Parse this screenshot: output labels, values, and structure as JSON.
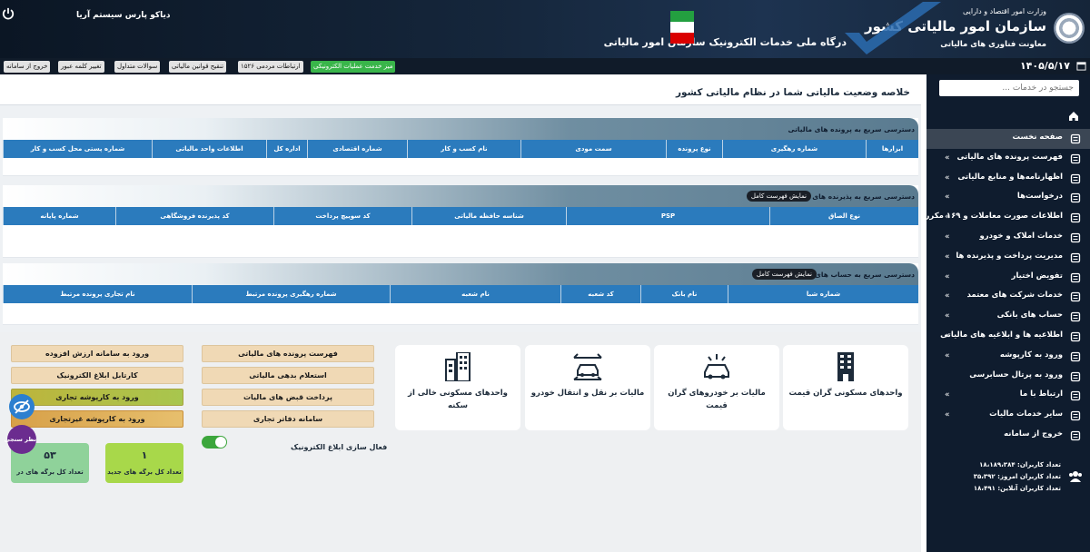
{
  "header": {
    "ministry": "وزارت امور اقتصاد و دارایی",
    "org": "سازمان امور مالیاتی کشور",
    "deputy": "معاونت فناوری های مالیاتی",
    "portal": "درگاه ملی خدمات الکترونیک سازمان امور مالیاتی",
    "system_name": "دیاکو پارس سیستم آریا"
  },
  "navrow": {
    "date": "۱۴۰۵/۵/۱۷",
    "links": [
      "میز خدمت عملیات الکترونیکی",
      "ارتباطات مردمی ۱۵۲۶",
      "تنقیح قوانین مالیاتی",
      "سوالات متداول",
      "تغییر کلمه عبور",
      "خروج از سامانه"
    ]
  },
  "sidebar": {
    "search_placeholder": "جستجو در خدمات ...",
    "items": [
      {
        "label": "صفحه نخست",
        "icon": "dashboard-icon",
        "arrow": false
      },
      {
        "label": "فهرست پرونده های مالیاتی",
        "icon": "building-icon",
        "arrow": true
      },
      {
        "label": "اظهارنامه‌ها و منابع مالیاتی",
        "icon": "document-icon",
        "arrow": true
      },
      {
        "label": "درخواست‌ها",
        "icon": "clipboard-icon",
        "arrow": true
      },
      {
        "label": "اطلاعات صورت معاملات و ۱۶۹ مکرر",
        "icon": "badge-icon",
        "arrow": true
      },
      {
        "label": "خدمات املاک و خودرو",
        "icon": "car-icon",
        "arrow": true
      },
      {
        "label": "مدیریت پرداخت و پذیرنده ها",
        "icon": "card-icon",
        "arrow": true
      },
      {
        "label": "تفویض اختیار",
        "icon": "delegate-icon",
        "arrow": true
      },
      {
        "label": "خدمات شرکت های معتمد",
        "icon": "seal-icon",
        "arrow": true
      },
      {
        "label": "حساب های بانکی",
        "icon": "bank-card-icon",
        "arrow": true
      },
      {
        "label": "اطلاعیه ها و ابلاغیه های مالیاتی",
        "icon": "bell-icon",
        "arrow": true
      },
      {
        "label": "ورود به کارپوشه",
        "icon": "folder-icon",
        "arrow": true
      },
      {
        "label": "ورود به پرتال حسابرسی",
        "icon": "audit-icon",
        "arrow": false
      },
      {
        "label": "ارتباط با ما",
        "icon": "mail-icon",
        "arrow": true
      },
      {
        "label": "سایر خدمات مالیات",
        "icon": "recycle-icon",
        "arrow": true
      },
      {
        "label": "خروج از سامانه",
        "icon": "logout-icon",
        "arrow": false
      }
    ],
    "stats": [
      "تعداد کاربران: ۱۸،۱۸۹،۳۸۴",
      "تعداد کاربران امروز: ۳۵،۳۹۲",
      "تعداد کاربران آنلاین: ۱۸،۴۹۱"
    ]
  },
  "main": {
    "status_title": "خلاصه وضعیت مالیاتی شما در نظام مالیاتی کشور",
    "panels": [
      {
        "title": "دسترسی سریع به پرونده های مالیاتی",
        "button": "",
        "columns": [
          "ابزارها",
          "شماره رهگیری",
          "نوع پرونده",
          "سمت مودی",
          "نام کسب و کار",
          "شماره اقتصادی",
          "اداره کل",
          "اطلاعات واحد مالیاتی",
          "شماره پستی محل کسب و کار"
        ]
      },
      {
        "title": "دسترسی سریع به پذیرنده های بانکی",
        "button": "نمایش فهرست کامل",
        "columns": [
          "نوع الصاق",
          "PSP",
          "شناسه حافظه مالیاتی",
          "کد سوییچ پرداخت",
          "کد پذیرنده فروشگاهی",
          "شماره پایانه"
        ]
      },
      {
        "title": "دسترسی سریع به حساب های بانکی",
        "button": "نمایش فهرست کامل",
        "columns": [
          "شماره شبا",
          "نام بانک",
          "کد شعبه",
          "نام شعبه",
          "شماره رهگیری پرونده مرتبط",
          "نام تجاری پرونده مرتبط"
        ]
      }
    ]
  },
  "tiles": [
    {
      "label": "واحدهای مسکونی گران قیمت",
      "icon": "apartment-icon"
    },
    {
      "label": "مالیات بر خودروهای گران قیمت",
      "icon": "luxury-car-icon"
    },
    {
      "label": "مالیات بر نقل و انتقال خودرو",
      "icon": "car-transfer-icon"
    },
    {
      "label": "واحدهای مسکونی خالی از سکنه",
      "icon": "empty-building-icon"
    }
  ],
  "quick_buttons_col1": [
    "فهرست پرونده های مالیاتی",
    "استعلام بدهی مالیاتی",
    "پرداخت قبض های مالیات",
    "سامانه دفاتر تجاری"
  ],
  "quick_buttons_col2": [
    "ورود به سامانه ارزش افزوده",
    "کارتابل ابلاغ الکترونیک",
    "ورود به کارپوشه تجاری",
    "ورود به کارپوشه غیرتجاری"
  ],
  "toggle": {
    "label": "فعال سازی ابلاغ الکترونیک",
    "on": true
  },
  "stat_cards": [
    {
      "value": "۱",
      "label": "تعداد کل برگه های جدید"
    },
    {
      "value": "۵۳",
      "label": "تعداد کل برگه های در"
    }
  ],
  "float": {
    "survey_label": "نظر سنجی"
  },
  "colors": {
    "sidebar": "#0f1c2e",
    "table_header": "#2b7bbd",
    "active_menu": "#3b4654",
    "accent_green": "#39b54a"
  }
}
